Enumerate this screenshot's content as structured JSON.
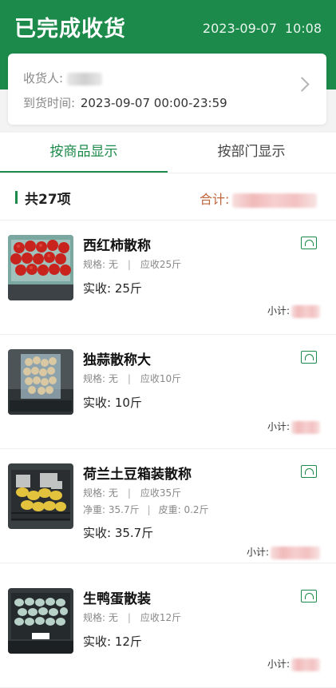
{
  "header": {
    "title": "已完成收货",
    "date": "2023-09-07",
    "time": "10:08"
  },
  "info_card": {
    "receiver_label": "收货人:",
    "arrival_label": "到货时间:",
    "arrival_value": "2023-09-07 00:00-23:59"
  },
  "tabs": [
    {
      "label": "按商品显示",
      "active": true
    },
    {
      "label": "按部门显示",
      "active": false
    }
  ],
  "summary": {
    "count_label": "共27项",
    "total_label": "合计:"
  },
  "items": [
    {
      "name": "西红柿散称",
      "spec": "规格: 无",
      "expected": "应收25斤",
      "received": "实收:  25斤",
      "subtotal_label": "小计:",
      "thumb": "tomato"
    },
    {
      "name": "独蒜散称大",
      "spec": "规格: 无",
      "expected": "应收10斤",
      "received": "实收:  10斤",
      "subtotal_label": "小计:",
      "thumb": "garlic"
    },
    {
      "name": "荷兰土豆箱装散称",
      "spec": "规格: 无",
      "expected": "应收35斤",
      "net": "净重: 35.7斤",
      "tare": "皮重: 0.2斤",
      "received": "实收:  35.7斤",
      "subtotal_label": "小计:",
      "thumb": "potato"
    },
    {
      "name": "生鸭蛋散装",
      "spec": "规格: 无",
      "expected": "应收12斤",
      "received": "实收:  12斤",
      "subtotal_label": "小计:",
      "thumb": "egg"
    }
  ],
  "colors": {
    "brand": "#1c8a4a",
    "total": "#c0663d"
  }
}
